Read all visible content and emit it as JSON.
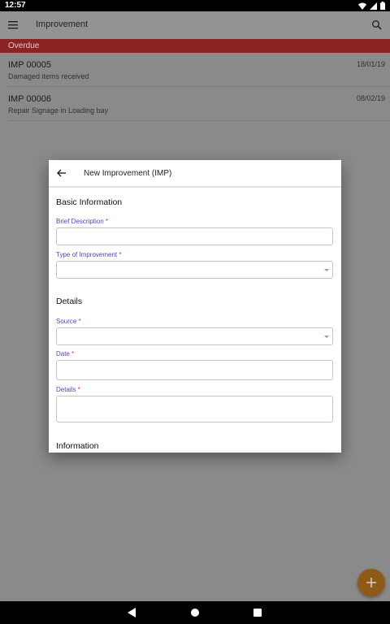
{
  "status_bar": {
    "time": "12:57"
  },
  "app_bar": {
    "title": "Improvement"
  },
  "section": {
    "label": "Overdue"
  },
  "items": [
    {
      "id": "IMP 00005",
      "description": "Damaged items received",
      "date": "18/01/19"
    },
    {
      "id": "IMP 00006",
      "description": "Repair Signage in Loading bay",
      "date": "08/02/19"
    }
  ],
  "dialog": {
    "title": "New Improvement (IMP)",
    "sections": {
      "basic": "Basic Information",
      "details": "Details",
      "information": "Information"
    },
    "fields": {
      "brief_description": {
        "label": "Brief Description",
        "value": ""
      },
      "type_of_improvement": {
        "label": "Type of Improvement",
        "value": ""
      },
      "source": {
        "label": "Source",
        "value": ""
      },
      "date": {
        "label": "Date",
        "value": ""
      },
      "details": {
        "label": "Details",
        "value": ""
      }
    },
    "required_marker": "*"
  },
  "colors": {
    "section_header": "#8a2323",
    "fab": "#8f5a18",
    "label_accent": "#5b3fc4",
    "required": "#e53935"
  },
  "icons": [
    "menu-icon",
    "search-icon",
    "arrow-back-icon",
    "plus-icon",
    "wifi-icon",
    "signal-icon",
    "battery-icon"
  ]
}
